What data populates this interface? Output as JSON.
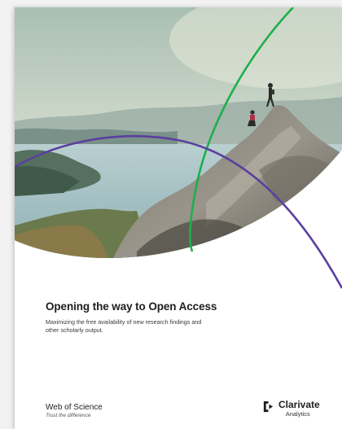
{
  "document": {
    "title": "Opening the way to Open Access",
    "subtitle": "Maximizing the free availability of new research findings and other scholarly output."
  },
  "branding": {
    "product_name": "Web of Science",
    "product_tagline": "Trust the difference",
    "company_name": "Clarivate",
    "company_sub": "Analytics"
  },
  "colors": {
    "green_arc": "#1fae4b",
    "purple_arc": "#5b3fa0",
    "brand_mark": "#1e1e1e"
  }
}
